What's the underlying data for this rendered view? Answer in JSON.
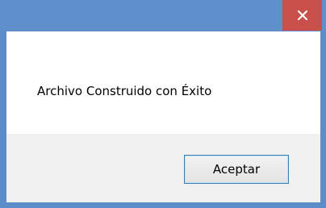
{
  "dialog": {
    "message": "Archivo Construido con Éxito",
    "ok_label": "Aceptar",
    "close_glyph": "×"
  },
  "colors": {
    "frame": "#5f90cc",
    "close_button": "#c9504a",
    "content_bg": "#ffffff",
    "footer_bg": "#f0f0f0",
    "button_border": "#3c7fb1"
  },
  "icons": {
    "close": "close-icon"
  }
}
